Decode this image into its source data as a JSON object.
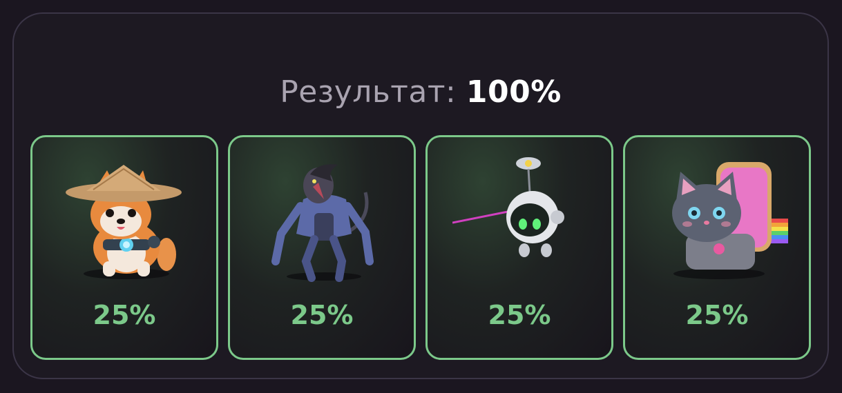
{
  "result": {
    "label": "Результат:",
    "value": "100%"
  },
  "cards": [
    {
      "character": "shiba-dog-with-straw-hat",
      "percent": "25%"
    },
    {
      "character": "robot-werewolf",
      "percent": "25%"
    },
    {
      "character": "round-robot-with-laser",
      "percent": "25%"
    },
    {
      "character": "robot-cat-with-toast",
      "percent": "25%"
    }
  ],
  "colors": {
    "accent": "#7cc98a",
    "background": "#1b1620",
    "panel_border": "#3b3547"
  }
}
